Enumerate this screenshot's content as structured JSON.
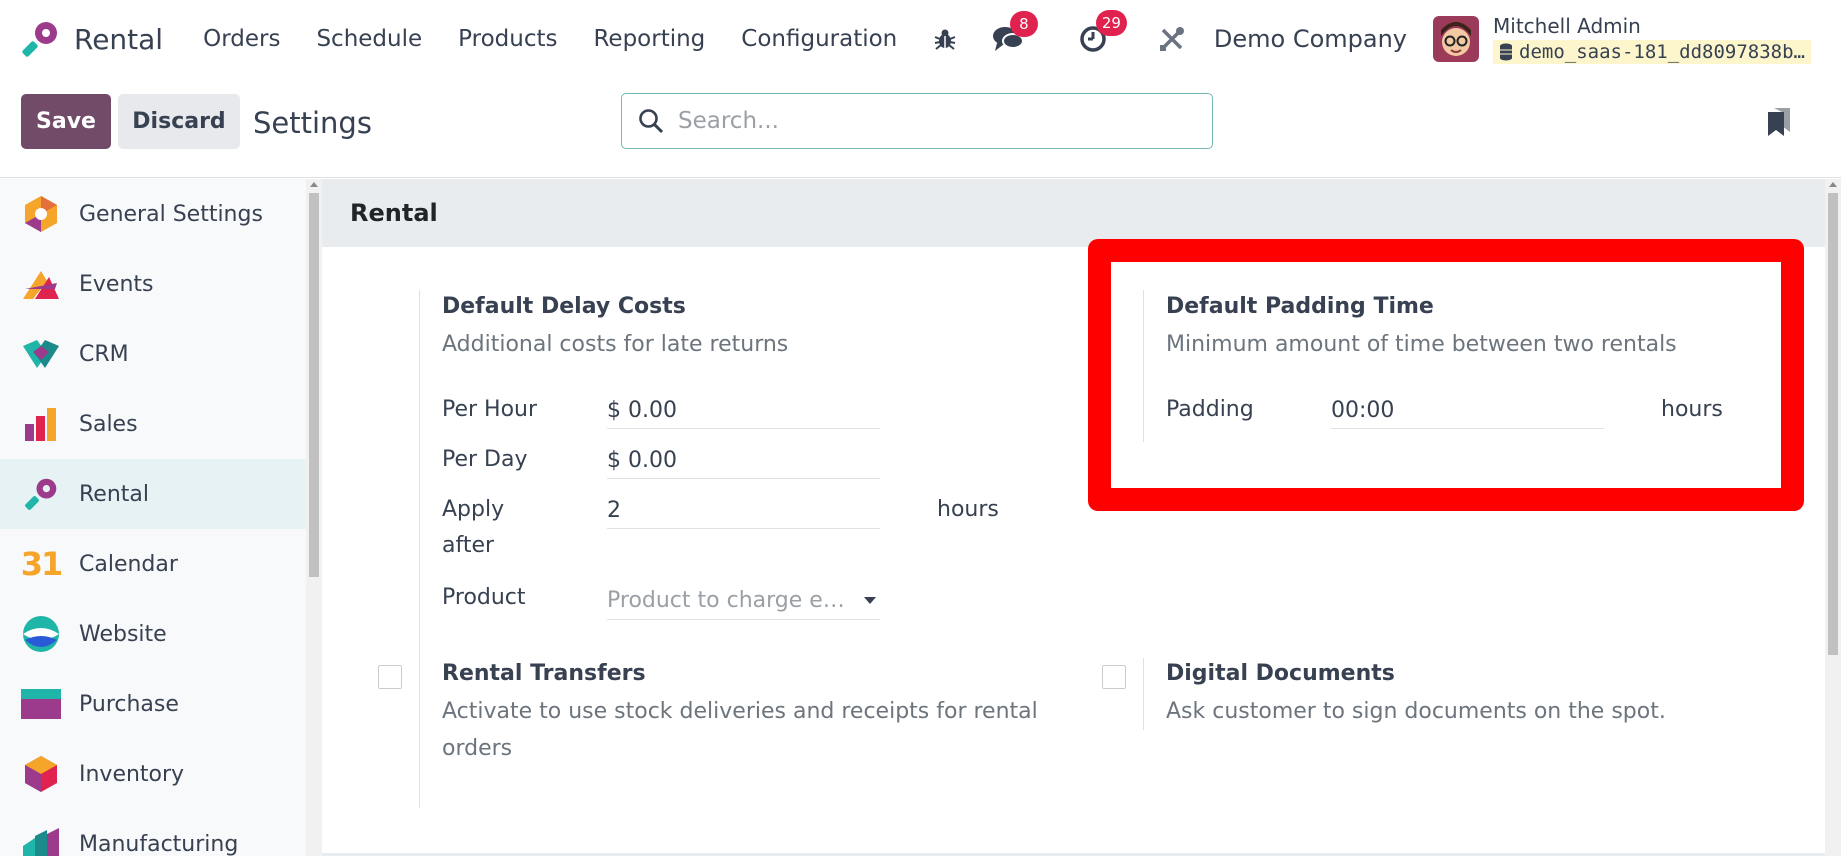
{
  "navbar": {
    "app_name": "Rental",
    "menu": [
      "Orders",
      "Schedule",
      "Products",
      "Reporting",
      "Configuration"
    ],
    "messages_count": "8",
    "activities_count": "29",
    "company": "Demo Company",
    "user_name": "Mitchell Admin",
    "database": "demo_saas-181_dd8097838b…"
  },
  "control": {
    "save_label": "Save",
    "discard_label": "Discard",
    "title": "Settings",
    "search_placeholder": "Search..."
  },
  "sidebar": {
    "items": [
      {
        "label": "General Settings",
        "icon": "general-settings-icon"
      },
      {
        "label": "Events",
        "icon": "events-icon"
      },
      {
        "label": "CRM",
        "icon": "crm-icon"
      },
      {
        "label": "Sales",
        "icon": "sales-icon"
      },
      {
        "label": "Rental",
        "icon": "rental-icon",
        "active": true
      },
      {
        "label": "Calendar",
        "icon": "calendar-icon",
        "icon_text": "31"
      },
      {
        "label": "Website",
        "icon": "website-icon"
      },
      {
        "label": "Purchase",
        "icon": "purchase-icon"
      },
      {
        "label": "Inventory",
        "icon": "inventory-icon"
      },
      {
        "label": "Manufacturing",
        "icon": "manufacturing-icon"
      }
    ]
  },
  "section": {
    "title": "Rental",
    "delay_costs": {
      "title": "Default Delay Costs",
      "description": "Additional costs for late returns",
      "per_hour_label": "Per Hour",
      "per_hour_value": "$ 0.00",
      "per_day_label": "Per Day",
      "per_day_value": "$ 0.00",
      "apply_after_label_1": "Apply",
      "apply_after_label_2": "after",
      "apply_after_value": "2",
      "apply_after_unit": "hours",
      "product_label": "Product",
      "product_placeholder": "Product to charge e…"
    },
    "padding_time": {
      "title": "Default Padding Time",
      "description": "Minimum amount of time between two rentals",
      "padding_label": "Padding",
      "padding_value": "00:00",
      "padding_unit": "hours"
    },
    "transfers": {
      "title": "Rental Transfers",
      "description_1": "Activate to use stock deliveries and receipts for rental",
      "description_2": "orders"
    },
    "digital_docs": {
      "title": "Digital Documents",
      "description": "Ask customer to sign documents on the spot."
    }
  },
  "colors": {
    "primary": "#714b67",
    "badge": "#e0234e",
    "highlight": "#ff0000",
    "active_item_bg": "#e6f2f3"
  }
}
